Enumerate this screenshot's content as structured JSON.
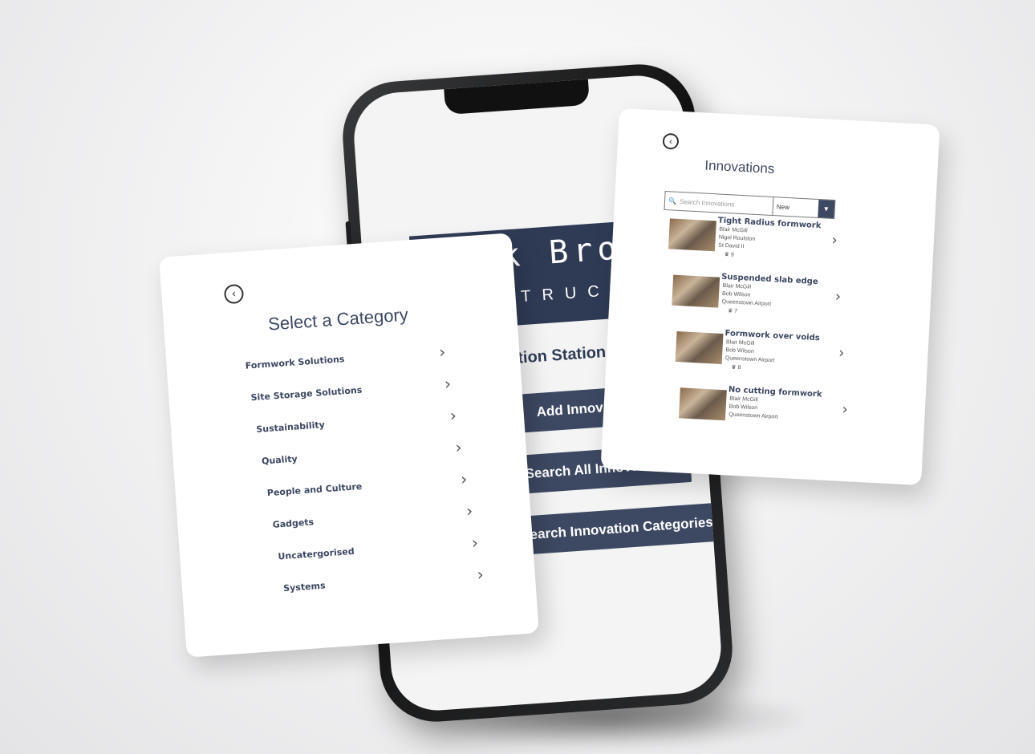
{
  "phone": {
    "logo_main": "Cook Brothers",
    "logo_sub": "CONSTRUCTION",
    "station_title": "Innovation Station",
    "buttons": {
      "add": "Add Innovation",
      "search_all": "Search All Innovations",
      "search_categories": "Search Innovation Categories"
    },
    "colors": {
      "brand": "#2f3b55",
      "button": "#3d4862"
    }
  },
  "category_card": {
    "back_icon": "back-icon",
    "title": "Select a Category",
    "items": [
      {
        "label": "Formwork Solutions"
      },
      {
        "label": "Site Storage Solutions"
      },
      {
        "label": "Sustainability"
      },
      {
        "label": "Quality"
      },
      {
        "label": "People and Culture"
      },
      {
        "label": "Gadgets"
      },
      {
        "label": "Uncatergorised"
      },
      {
        "label": "Systems"
      }
    ]
  },
  "innovations_card": {
    "back_icon": "back-icon",
    "title": "Innovations",
    "search_placeholder": "Search Innovations",
    "sort_value": "New",
    "items": [
      {
        "name": "Tight Radius formwork",
        "author": "Blair McGill",
        "contact": "Nigel Roulston",
        "site": "St David II",
        "votes": "9"
      },
      {
        "name": "Suspended slab edge",
        "author": "Blair McGill",
        "contact": "Bob Wilson",
        "site": "Queenstown Airport",
        "votes": "7"
      },
      {
        "name": "Formwork over voids",
        "author": "Blair McGill",
        "contact": "Bob Wilson",
        "site": "Queenstown Airport",
        "votes": "8"
      },
      {
        "name": "No cutting formwork",
        "author": "Blair McGill",
        "contact": "Bob Wilson",
        "site": "Queenstown Airport",
        "votes": ""
      }
    ]
  }
}
